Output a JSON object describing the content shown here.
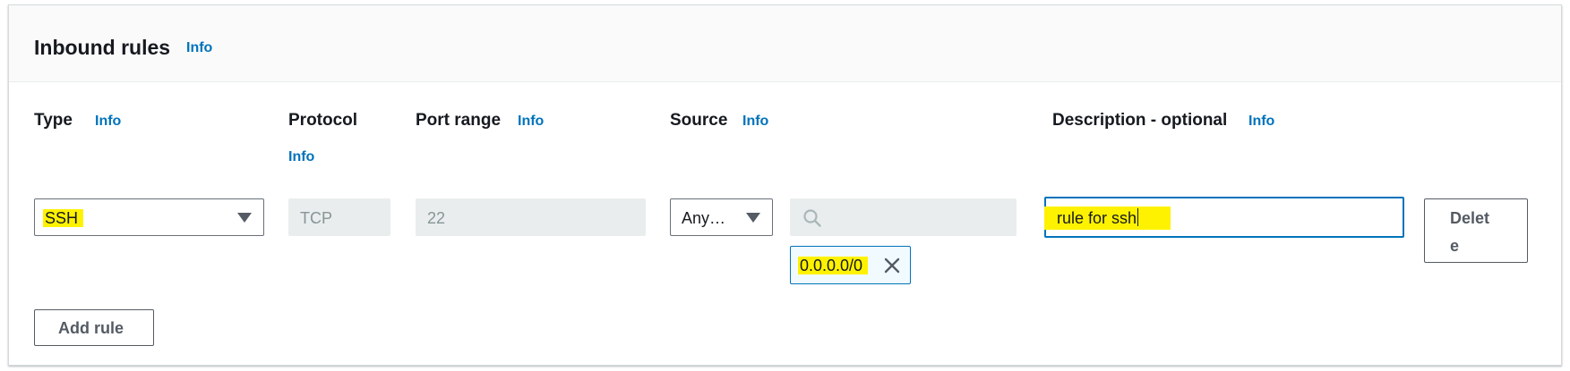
{
  "panel": {
    "title": "Inbound rules",
    "info": "Info"
  },
  "columns": {
    "type": {
      "label": "Type",
      "info": "Info"
    },
    "protocol": {
      "label": "Protocol",
      "info": "Info"
    },
    "port_range": {
      "label": "Port range",
      "info": "Info"
    },
    "source": {
      "label": "Source",
      "info": "Info"
    },
    "description": {
      "label": "Description - optional",
      "info": "Info"
    }
  },
  "rule": {
    "type_value": "SSH",
    "protocol_value": "TCP",
    "port_value": "22",
    "source_select": "Any…",
    "source_token": "0.0.0.0/0",
    "description_value": "rule for ssh",
    "delete_line1": "Delet",
    "delete_line2": "e"
  },
  "actions": {
    "add_rule": "Add rule"
  },
  "colors": {
    "accent": "#0073bb",
    "highlight": "#fff200"
  },
  "icons": {
    "search": "search-icon",
    "remove": "close-icon",
    "dropdown": "caret-down-icon"
  }
}
